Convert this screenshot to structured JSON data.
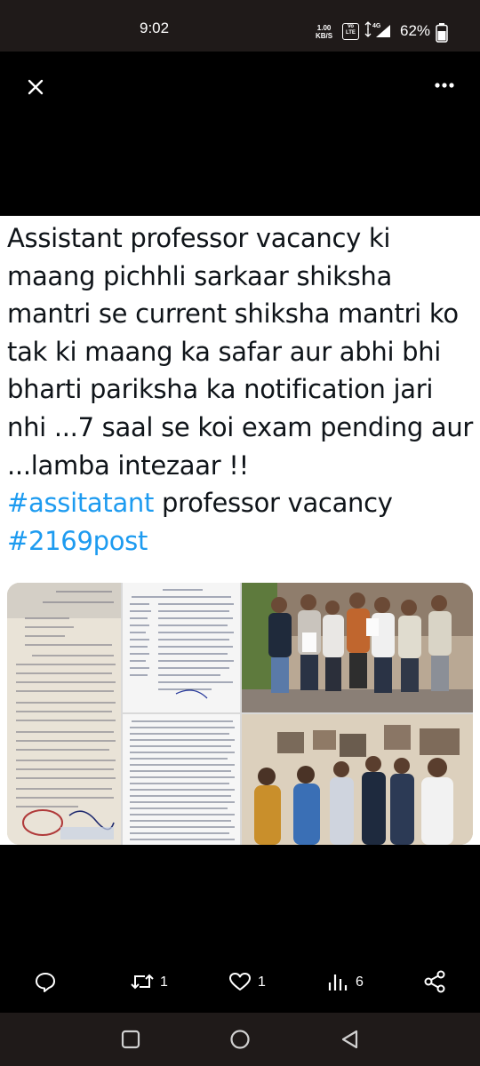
{
  "status_bar": {
    "time": "9:02",
    "speed_value": "1.00",
    "speed_unit": "KB/S",
    "volte_top": "Vo",
    "volte_bottom": "LTE",
    "network": "4G",
    "battery_percent": "62%"
  },
  "tweet": {
    "text_plain": "Assistant professor vacancy ki maang pichhli sarkaar shiksha mantri se current shiksha mantri ko tak ki maang ka safar aur abhi bhi bharti pariksha ka notification jari nhi ...7 saal se koi exam pending aur ...lamba intezaar !!",
    "hashtag_1": "#assitatant",
    "after_hashtag_1": " professor vacancy",
    "hashtag_2": "#2169post"
  },
  "media": {
    "images": [
      {
        "kind": "document-photo",
        "description": "hindi-letter-1"
      },
      {
        "kind": "document-scan",
        "description": "hindi-letter-2"
      },
      {
        "kind": "photo",
        "description": "group-photo-1"
      },
      {
        "kind": "document-scan",
        "description": "hindi-letter-3"
      },
      {
        "kind": "photo",
        "description": "group-photo-2"
      }
    ]
  },
  "actions": {
    "replies": "",
    "retweets": "1",
    "likes": "1",
    "views": "6"
  },
  "colors": {
    "hashtag": "#1d9bf0",
    "text": "#0f1419",
    "status_bg": "#1f1a19"
  }
}
